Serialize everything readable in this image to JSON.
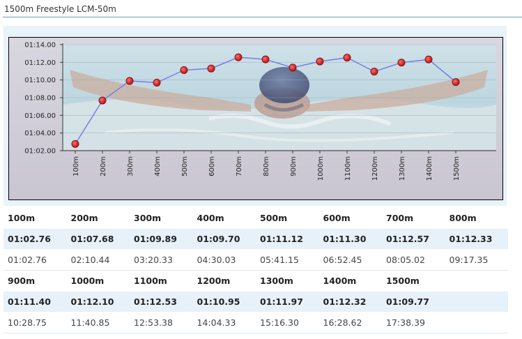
{
  "page": {
    "title": "1500m Freestyle LCM-50m"
  },
  "colors": {
    "line": "#6f78e6",
    "marker_fill": "#e0202a",
    "marker_stroke": "#7a1010",
    "frame_bg": "#cfccd8",
    "table_stripe": "#e7f1f9"
  },
  "chart_data": {
    "type": "line",
    "title": "",
    "xlabel": "",
    "ylabel": "",
    "categories": [
      "100m",
      "200m",
      "300m",
      "400m",
      "500m",
      "600m",
      "700m",
      "800m",
      "900m",
      "1000m",
      "1100m",
      "1200m",
      "1300m",
      "1400m",
      "1500m"
    ],
    "values": [
      62.76,
      67.68,
      69.89,
      69.7,
      71.12,
      71.3,
      72.57,
      72.33,
      71.4,
      72.1,
      72.53,
      70.95,
      71.97,
      72.32,
      69.77
    ],
    "ylim": [
      62,
      74
    ],
    "yticks": [
      62,
      64,
      66,
      68,
      70,
      72,
      74
    ],
    "ytick_labels": [
      "01:02.00",
      "01:04.00",
      "01:06.00",
      "01:08.00",
      "01:10.00",
      "01:12.00",
      "01:14.00"
    ],
    "grid": true,
    "background_image": "swimmer-butterfly-photo",
    "legend": "none"
  },
  "table": {
    "blocks": [
      {
        "distances": [
          "100m",
          "200m",
          "300m",
          "400m",
          "500m",
          "600m",
          "700m",
          "800m"
        ],
        "splits": [
          "01:02.76",
          "01:07.68",
          "01:09.89",
          "01:09.70",
          "01:11.12",
          "01:11.30",
          "01:12.57",
          "01:12.33"
        ],
        "cumulative": [
          "01:02.76",
          "02:10.44",
          "03:20.33",
          "04:30.03",
          "05:41.15",
          "06:52.45",
          "08:05.02",
          "09:17.35"
        ]
      },
      {
        "distances": [
          "900m",
          "1000m",
          "1100m",
          "1200m",
          "1300m",
          "1400m",
          "1500m",
          ""
        ],
        "splits": [
          "01:11.40",
          "01:12.10",
          "01:12.53",
          "01:10.95",
          "01:11.97",
          "01:12.32",
          "01:09.77",
          ""
        ],
        "cumulative": [
          "10:28.75",
          "11:40.85",
          "12:53.38",
          "14:04.33",
          "15:16.30",
          "16:28.62",
          "17:38.39",
          ""
        ]
      }
    ]
  }
}
